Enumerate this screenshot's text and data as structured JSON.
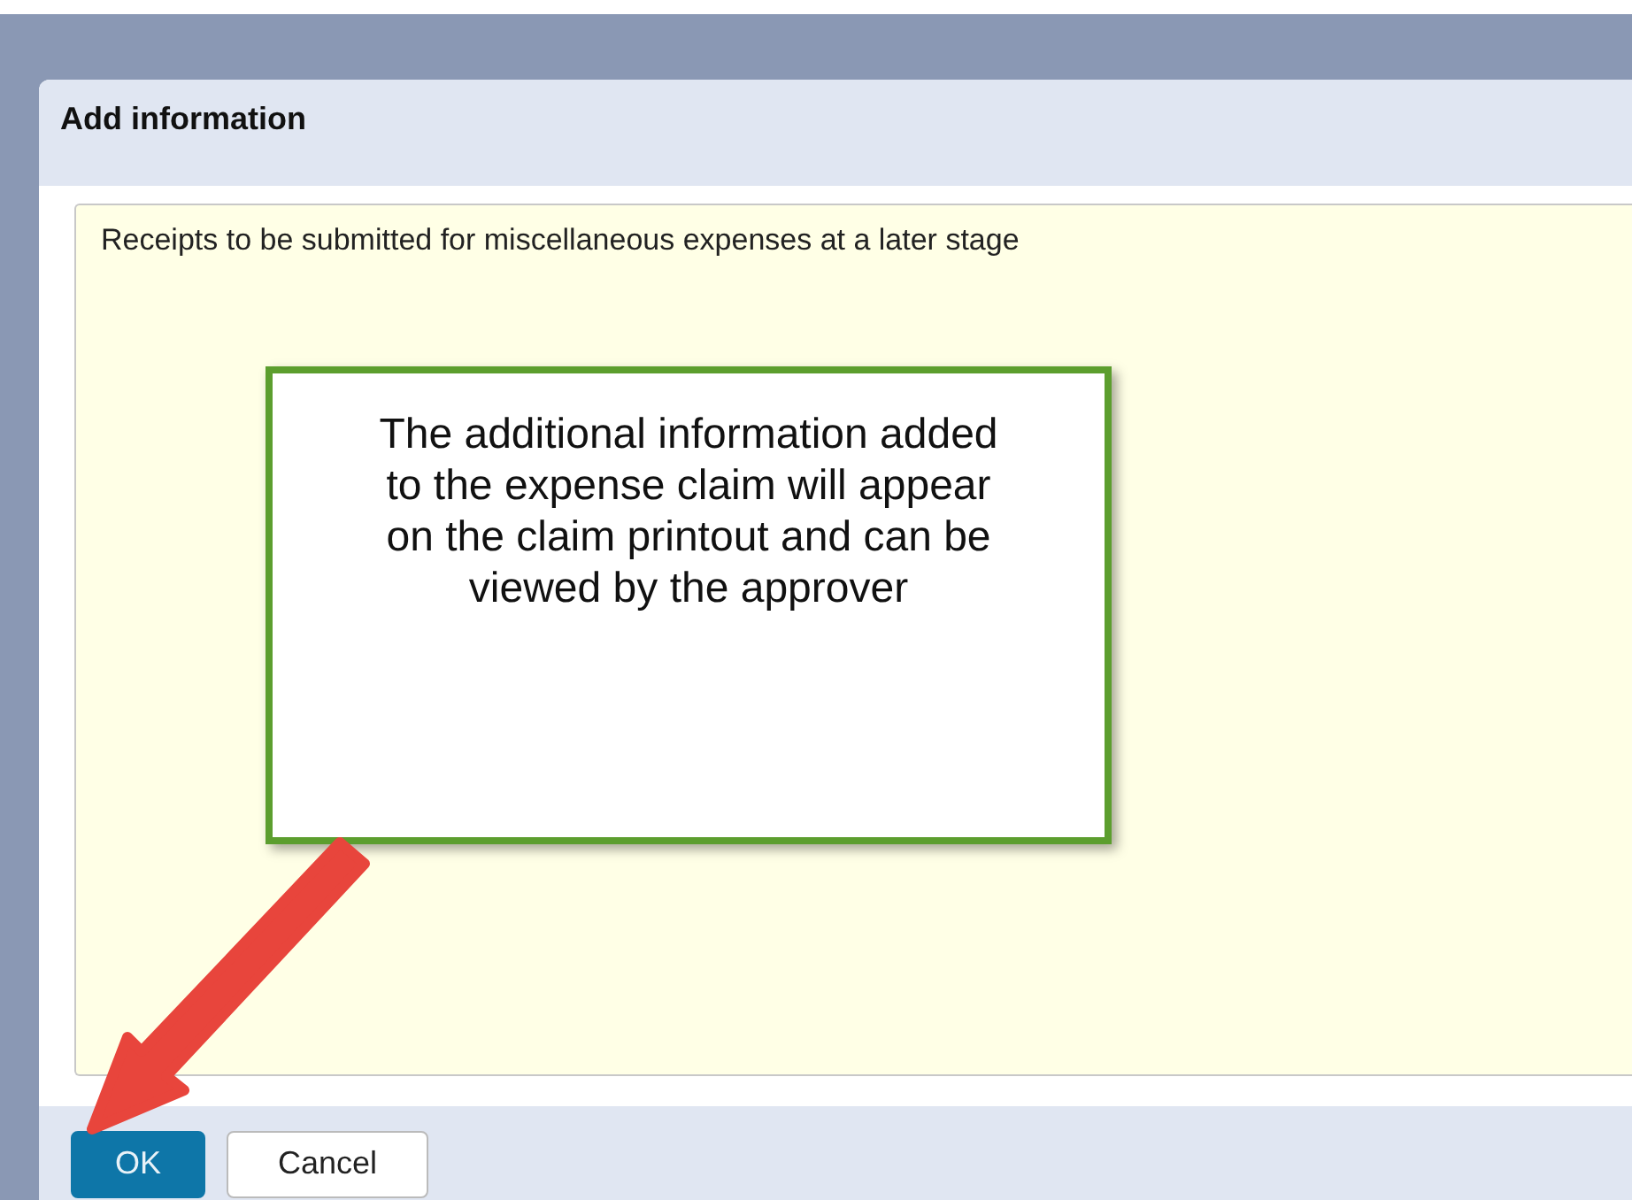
{
  "dialog": {
    "title": "Add information",
    "text_value": "Receipts to be submitted for miscellaneous expenses at a later stage",
    "buttons": [
      {
        "label": "OK",
        "kind": "primary"
      },
      {
        "label": "Cancel",
        "kind": "secondary"
      }
    ]
  },
  "callout": {
    "text": "The additional information added to the expense claim will appear on the claim printout and can be viewed by the approver"
  }
}
